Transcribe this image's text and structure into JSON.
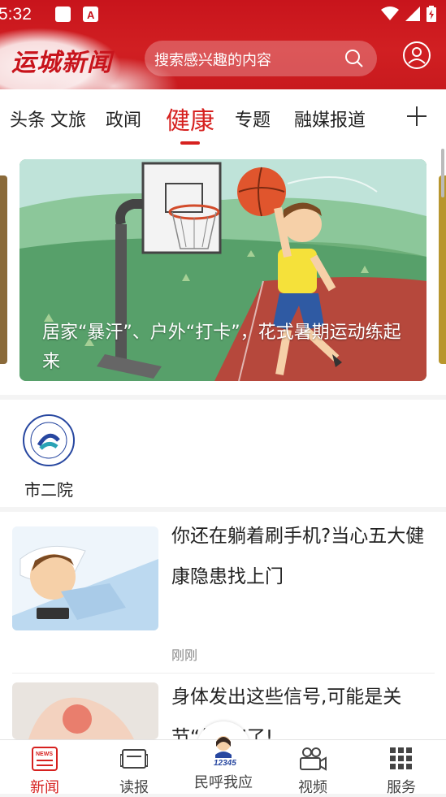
{
  "status_bar": {
    "time": "5:32"
  },
  "header": {
    "logo": "运城新闻",
    "search_placeholder": "搜索感兴趣的内容",
    "icons": [
      "search-icon",
      "user-avatar-icon"
    ],
    "color": "#c8141c"
  },
  "tabs": [
    {
      "label": "头条"
    },
    {
      "label": "文旅"
    },
    {
      "label": "政闻"
    },
    {
      "label": "健康",
      "active": true
    },
    {
      "label": "专题"
    },
    {
      "label": "融媒报道"
    }
  ],
  "accent_color": "#d6211f",
  "banner": {
    "caption": "居家“暴汗”、户外“打卡”，花式暑期运动练起来"
  },
  "channels": [
    {
      "label": "市二院",
      "icon": "hospital-logo-icon"
    }
  ],
  "news": [
    {
      "title": "你还在躺着刷手机?当心五大健康隐患找上门",
      "time": "刚刚"
    },
    {
      "title": "身体发出这些信号,可能是关节“生锈”了!",
      "time": ""
    }
  ],
  "bottom_nav": [
    {
      "label": "新闻",
      "icon": "news-icon",
      "active": true
    },
    {
      "label": "读报",
      "icon": "newspaper-icon"
    },
    {
      "label": "民呼我应",
      "icon": "hotline-12345-icon",
      "badge": "12345"
    },
    {
      "label": "视频",
      "icon": "video-icon"
    },
    {
      "label": "服务",
      "icon": "grid-icon"
    }
  ]
}
